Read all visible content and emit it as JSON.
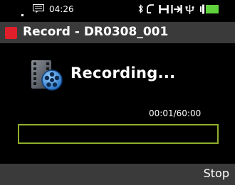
{
  "statusbar": {
    "time": "04:26",
    "icons": [
      "sd-card-icon",
      "bluetooth-icon",
      "headset-icon",
      "hd-icon",
      "media-sync-icon",
      "usb-icon",
      "battery-icon"
    ],
    "battery_color": "#5fd23c"
  },
  "titlebar": {
    "title": "Record - DR0308_001",
    "record_color": "#e01f2a"
  },
  "main": {
    "status": "Recording...",
    "elapsed": "00:01/60:00",
    "level_border_color": "#8fae2d"
  },
  "softkeys": {
    "right_label": "Stop"
  }
}
